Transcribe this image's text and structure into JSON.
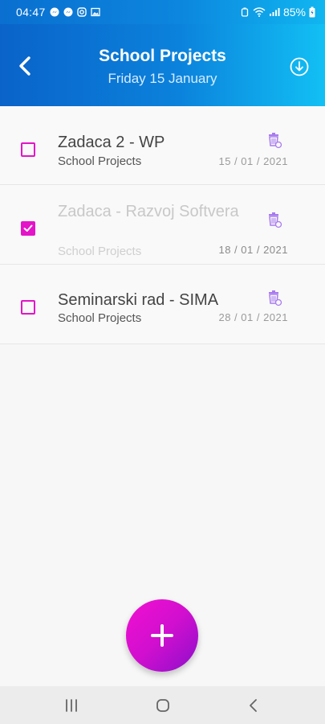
{
  "status_bar": {
    "time": "04:47",
    "battery": "85%",
    "notification_icons": [
      "messenger-icon",
      "messenger-icon",
      "instagram-icon",
      "image-icon"
    ],
    "system_icons": [
      "alarm-icon",
      "wifi-icon",
      "signal-icon",
      "battery-icon"
    ]
  },
  "header": {
    "title": "School Projects",
    "date": "Friday 15 January",
    "back_icon": "chevron-left-icon",
    "action_icon": "download-circle-icon",
    "gradient": [
      "#0a63c9",
      "#12c0f4"
    ]
  },
  "tasks": [
    {
      "title": "Zadaca 2 - WP",
      "subtitle": "School Projects",
      "date": "15 / 01 / 2021",
      "checked": false
    },
    {
      "title": "Zadaca - Razvoj Softvera",
      "subtitle": "School Projects",
      "date": "18 / 01 / 2021",
      "checked": true
    },
    {
      "title": "Seminarski rad - SIMA",
      "subtitle": "School Projects",
      "date": "28 / 01 / 2021",
      "checked": false
    }
  ],
  "colors": {
    "accent": "#e414c8",
    "delete_icon": "#a87bf0",
    "fab_gradient": [
      "#f20fd0",
      "#8c0fcb"
    ]
  },
  "fab": {
    "icon": "plus-icon"
  },
  "nav_bar": {
    "icons": [
      "recent-apps-icon",
      "home-icon",
      "back-icon"
    ]
  }
}
